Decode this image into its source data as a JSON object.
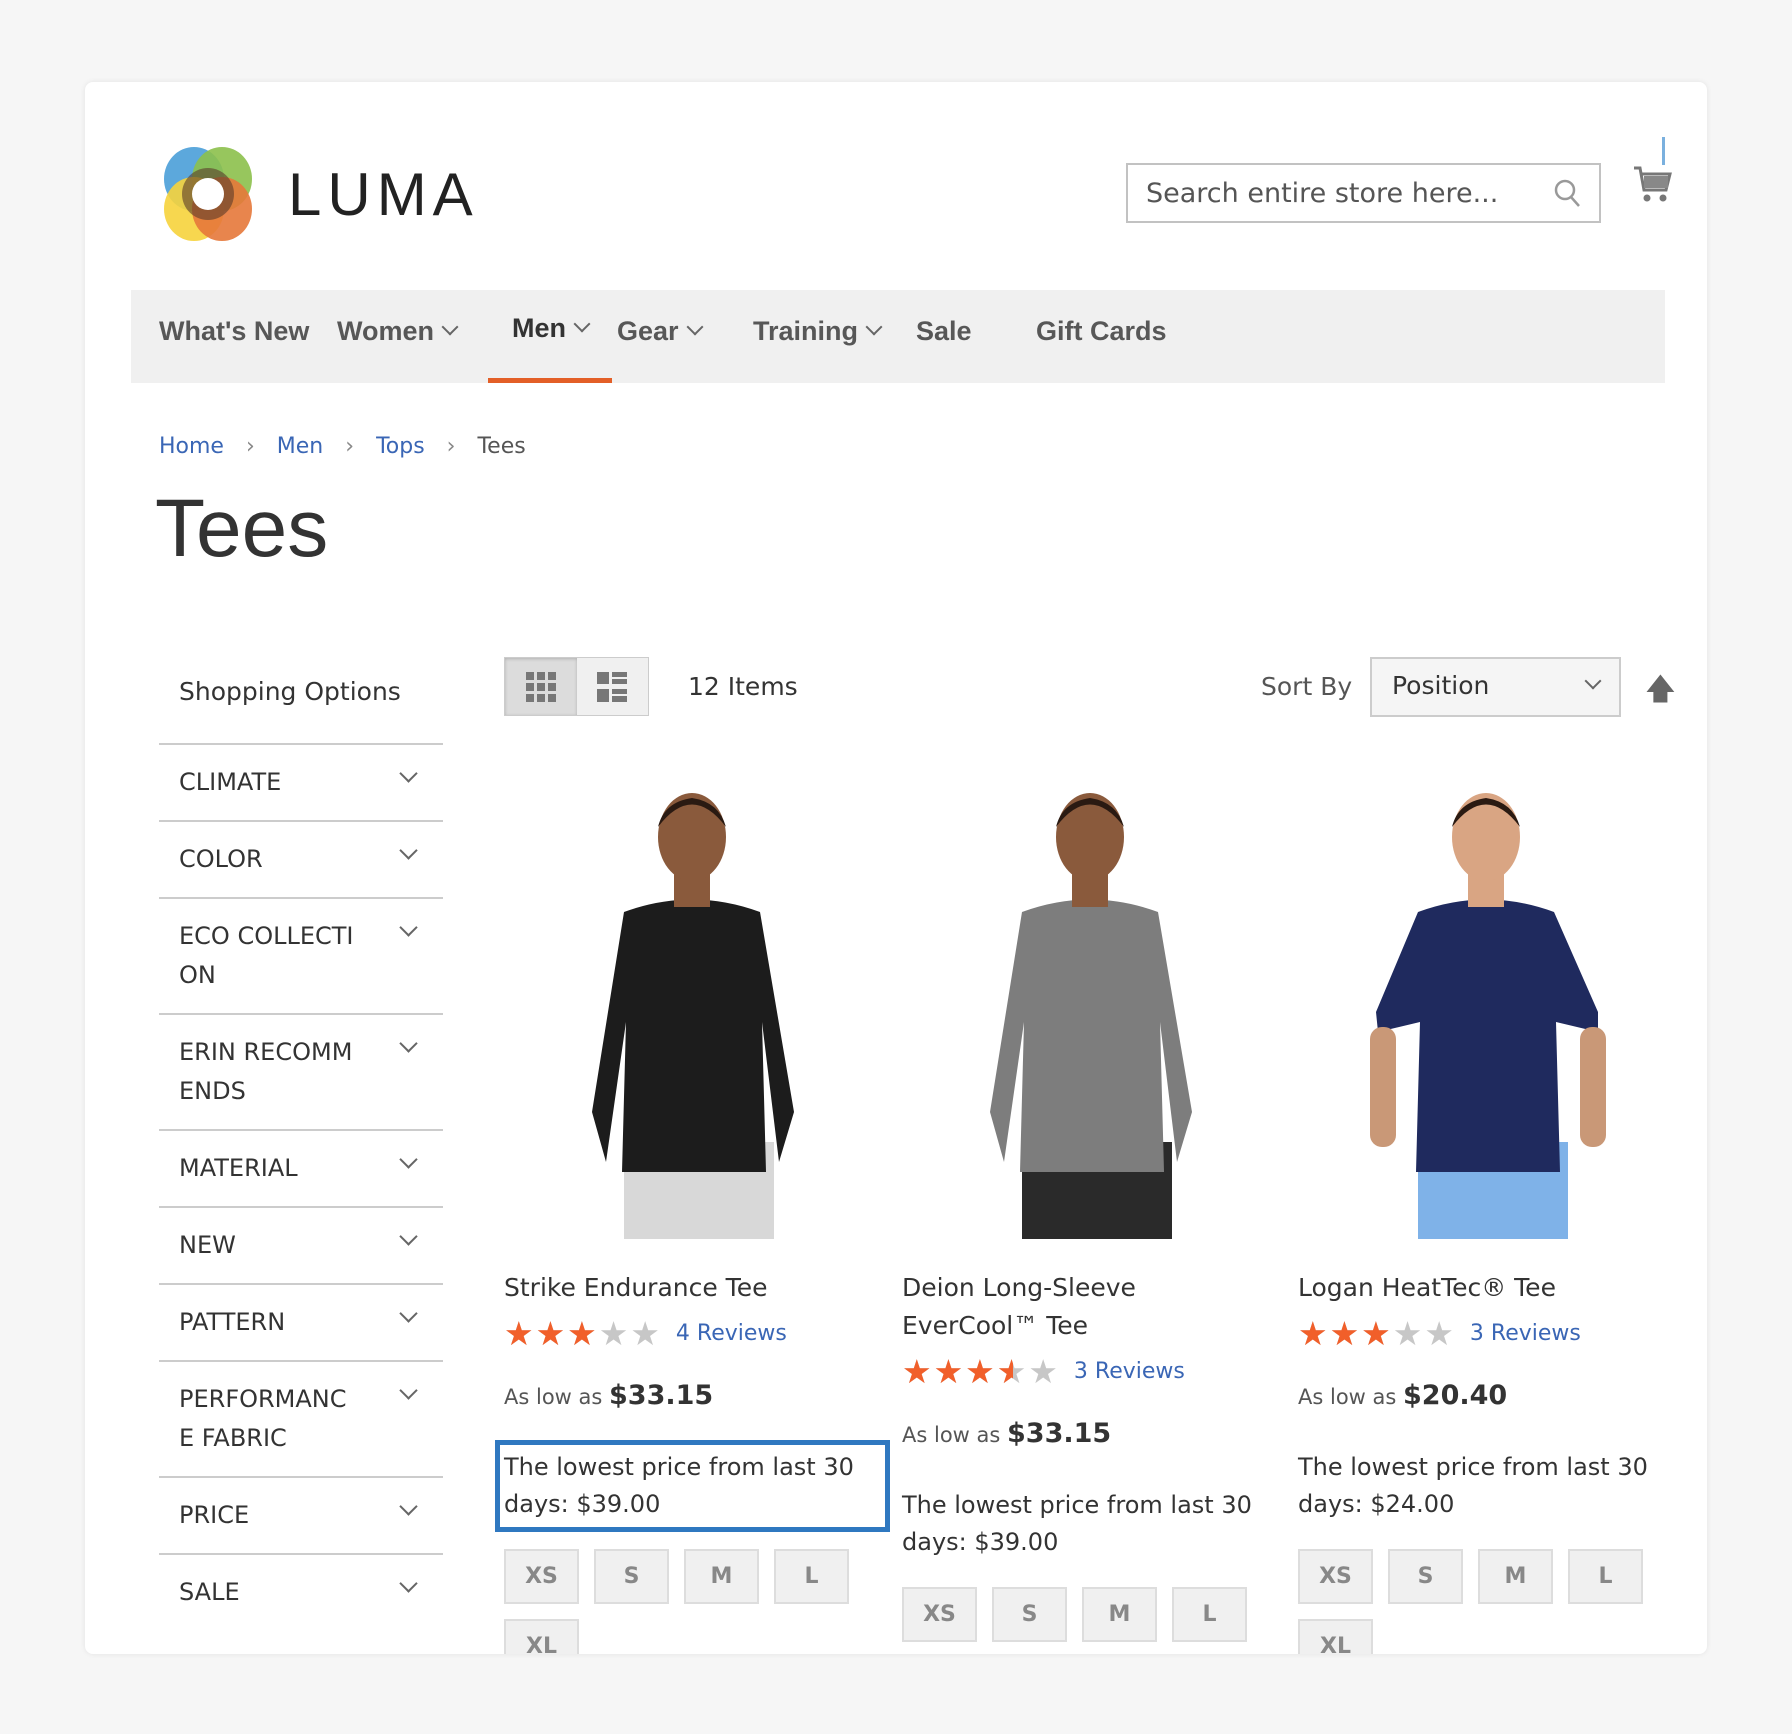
{
  "header": {
    "logo_text": "LUMA",
    "search_placeholder": "Search entire store here...",
    "cart_icon": "shopping-cart-icon"
  },
  "nav": [
    {
      "label": "What's New",
      "dropdown": false
    },
    {
      "label": "Women",
      "dropdown": true
    },
    {
      "label": "Men",
      "dropdown": true,
      "active": true
    },
    {
      "label": "Gear",
      "dropdown": true
    },
    {
      "label": "Training",
      "dropdown": true
    },
    {
      "label": "Sale",
      "dropdown": false
    },
    {
      "label": "Gift Cards",
      "dropdown": false
    }
  ],
  "breadcrumb": [
    "Home",
    "Men",
    "Tops",
    "Tees"
  ],
  "page_title": "Tees",
  "sidebar": {
    "title": "Shopping Options",
    "filters": [
      "CLIMATE",
      "COLOR",
      "ECO COLLECTI ON",
      "ERIN RECOMM ENDS",
      "MATERIAL",
      "NEW",
      "PATTERN",
      "PERFORMANC E FABRIC",
      "PRICE",
      "SALE"
    ]
  },
  "toolbar": {
    "items_count": "12 Items",
    "sort_label": "Sort By",
    "sort_value": "Position"
  },
  "products": [
    {
      "name": "Strike Endurance Tee",
      "rating_percent": 60,
      "reviews": "4  Reviews",
      "price_prefix": "As low as",
      "price": "$33.15",
      "lowest": "The lowest price from last 30 days: $39.00",
      "sizes": [
        "XS",
        "S",
        "M",
        "L",
        "XL"
      ],
      "shirt_color": "#1c1c1c",
      "shorts_color": "#d8d8d8",
      "highlighted": true
    },
    {
      "name": "Deion Long-Sleeve EverCool™ Tee",
      "rating_percent": 70,
      "reviews": "3  Reviews",
      "price_prefix": "As low as",
      "price": "$33.15",
      "lowest": "The lowest price from last 30 days: $39.00",
      "sizes": [
        "XS",
        "S",
        "M",
        "L"
      ],
      "shirt_color": "#7d7d7d",
      "shorts_color": "#2a2a2a",
      "highlighted": false
    },
    {
      "name": "Logan HeatTec® Tee",
      "rating_percent": 60,
      "reviews": "3  Reviews",
      "price_prefix": "As low as",
      "price": "$20.40",
      "lowest": "The lowest price from last 30 days: $24.00",
      "sizes": [
        "XS",
        "S",
        "M",
        "L",
        "XL"
      ],
      "shirt_color": "#1f2a5e",
      "shorts_color": "#7fb2e8",
      "highlighted": false
    }
  ],
  "colors": {
    "accent": "#e35f27",
    "link": "#3a66b5",
    "star": "#f15f2a",
    "highlight": "#2f78c0"
  }
}
